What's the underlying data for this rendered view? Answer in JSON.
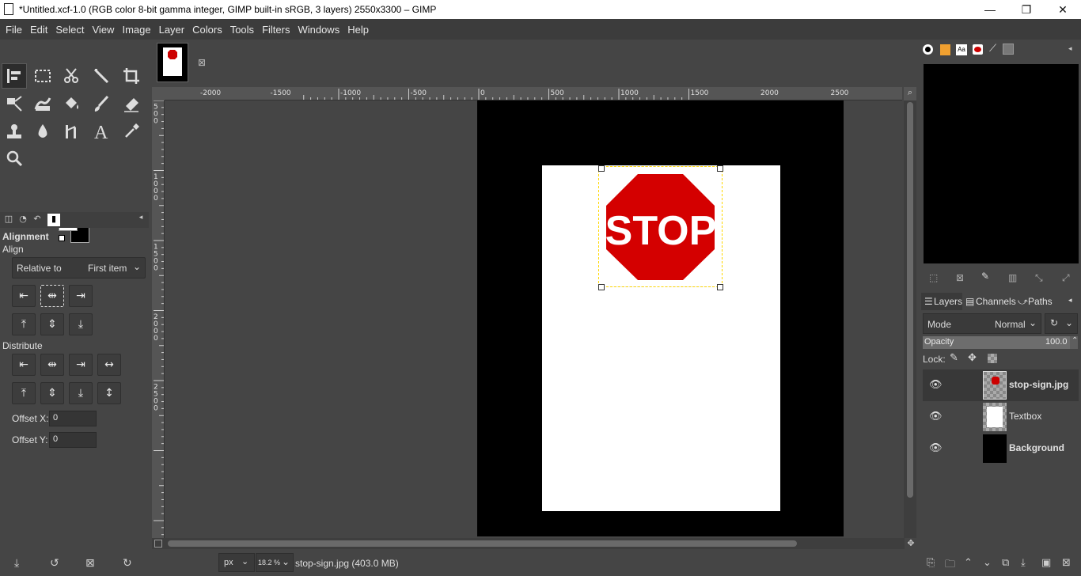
{
  "window": {
    "title": "*Untitled.xcf-1.0 (RGB color 8-bit gamma integer, GIMP built-in sRGB, 3 layers) 2550x3300 – GIMP",
    "minimize": "—",
    "maximize": "❐",
    "close": "✕"
  },
  "menu": [
    "File",
    "Edit",
    "Select",
    "View",
    "Image",
    "Layer",
    "Colors",
    "Tools",
    "Filters",
    "Windows",
    "Help"
  ],
  "toolbox": {
    "tools": [
      "align-tool",
      "rect-select-tool",
      "scissors-tool",
      "fuzzy-select-tool",
      "crop-tool",
      "transform-tool",
      "warp-tool",
      "bucket-fill-tool",
      "paintbrush-tool",
      "eraser-tool",
      "clone-tool",
      "smudge-tool",
      "dodge-tool",
      "text-tool",
      "color-picker-tool",
      "zoom-tool"
    ],
    "fg_color": "#ffffff",
    "bg_color": "#000000"
  },
  "alignment": {
    "title": "Alignment",
    "align_label": "Align",
    "relative_label": "Relative to",
    "relative_value": "First item",
    "distribute_label": "Distribute",
    "offset_x_label": "Offset X:",
    "offset_x_value": "0",
    "offset_y_label": "Offset Y:",
    "offset_y_value": "0"
  },
  "rulers": {
    "h_ticks": [
      "-2000",
      "-1500",
      "-1000",
      "-500",
      "0",
      "500",
      "1000",
      "1500",
      "2000",
      "2500"
    ],
    "v_ticks": [
      "500",
      "1000",
      "1500",
      "2000",
      "2500"
    ]
  },
  "canvas": {
    "stop_text": "STOP"
  },
  "status": {
    "unit": "px",
    "zoom": "18.2 %",
    "info": "stop-sign.jpg (403.0 MB)"
  },
  "layers_panel": {
    "tabs": [
      "Layers",
      "Channels",
      "Paths"
    ],
    "mode_label": "Mode",
    "mode_value": "Normal",
    "opacity_label": "Opacity",
    "opacity_value": "100.0",
    "lock_label": "Lock:",
    "layers": [
      {
        "name": "stop-sign.jpg",
        "bold": true
      },
      {
        "name": "Textbox",
        "bold": false
      },
      {
        "name": "Background",
        "bold": true
      }
    ]
  }
}
